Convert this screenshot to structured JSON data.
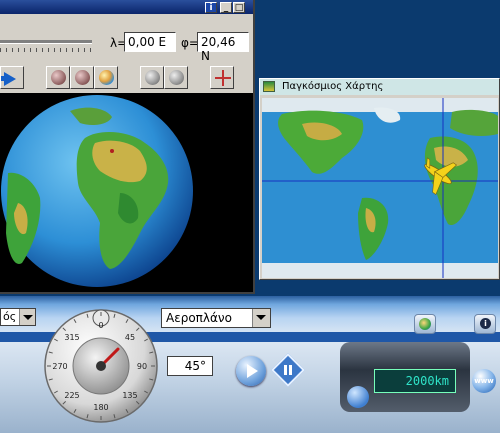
{
  "globe_window": {
    "title_buttons": [
      "i",
      "_",
      "□"
    ],
    "lambda_label": "λ=",
    "lambda_value": "0,00 E",
    "phi_label": "φ=",
    "phi_value": "20,46 N",
    "toolbar": [
      {
        "icon": "arrow-right-icon"
      },
      {
        "icon": "rotate-globe-icon"
      },
      {
        "icon": "globe-view-icon"
      },
      {
        "icon": "earth-icon"
      },
      {
        "icon": "zoom-in-icon"
      },
      {
        "icon": "zoom-out-icon"
      },
      {
        "icon": "crosshair-icon"
      }
    ]
  },
  "map_window": {
    "title": "Παγκόσμιος Χάρτης"
  },
  "deck": {
    "left_select_value": "ός",
    "mode_select_value": "Αεροπλάνο",
    "angle_value": "45°",
    "distance_value": "2000km",
    "www_label": "www",
    "info_label": "i"
  },
  "compass": {
    "labels": [
      "0",
      "45",
      "90",
      "135",
      "180",
      "225",
      "270",
      "315"
    ],
    "heading": 45
  },
  "colors": {
    "deck_blue": "#1f57a7",
    "titlebar": "#0a246a",
    "display_text": "#2fe3c8"
  }
}
